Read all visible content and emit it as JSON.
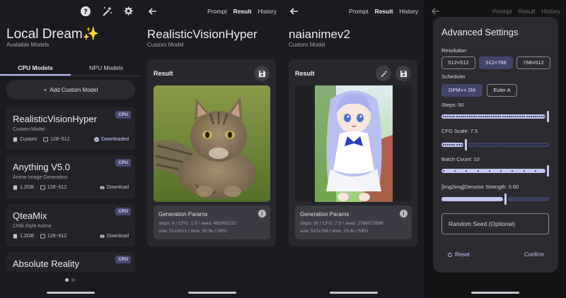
{
  "home": {
    "title": "Local Dream✨",
    "subtitle": "Available Models",
    "tabs": [
      "CPU Models",
      "NPU Models"
    ],
    "add_button": "Add Custom Model",
    "models": [
      {
        "name": "RealisticVisionHyper",
        "desc": "Custom Model",
        "badge": "CPU",
        "size": "Custom",
        "res": "128~512",
        "status": "Downloaded"
      },
      {
        "name": "Anything V5.0",
        "desc": "Anime Image Generation",
        "badge": "CPU",
        "size": "1.2GB",
        "res": "128~512",
        "status": "Download"
      },
      {
        "name": "QteaMix",
        "desc": "Chibi Style Anime",
        "badge": "CPU",
        "size": "1.2GB",
        "res": "128~512",
        "status": "Download"
      },
      {
        "name": "Absolute Reality",
        "desc": "",
        "badge": "CPU",
        "size": "",
        "res": "",
        "status": ""
      }
    ],
    "page_dots": 2,
    "active_dot": 0
  },
  "nav": {
    "prompt": "Prompt",
    "result": "Result",
    "history": "History"
  },
  "result1": {
    "title": "RealisticVisionHyper",
    "subtitle": "Custom Model",
    "card_title": "Result",
    "params_title": "Generation Params",
    "line1": "steps: 8 / CFG: 1.5 / seed: 461092232",
    "line2": "size: 512x512 / time: 30.9s / GPU"
  },
  "result2": {
    "title": "naianimev2",
    "subtitle": "Custom Model",
    "card_title": "Result",
    "params_title": "Generation Params",
    "line1": "steps: 50 / CFG: 7.5 / seed: 1788573599",
    "line2": "size: 512x768 / time: 23.8s / NPU"
  },
  "settings": {
    "title": "Advanced Settings",
    "resolution_label": "Resolution",
    "resolutions": [
      "512×512",
      "512×768",
      "768×512"
    ],
    "selected_resolution": "512×768",
    "scheduler_label": "Scheduler",
    "schedulers": [
      "DPM++ 2M",
      "Euler A"
    ],
    "selected_scheduler": "DPM++ 2M",
    "steps_label": "Steps: 50",
    "steps_fraction": 1.0,
    "cfg_label": "CFG Scale: 7.5",
    "cfg_fraction": 0.22,
    "batch_label": "Batch Count: 10",
    "batch_fraction": 1.0,
    "denoise_label": "[img2img]Denoise Strength: 0.60",
    "denoise_fraction": 0.6,
    "seed_placeholder": "Random Seed (Optional)",
    "reset": "Reset",
    "confirm": "Confirm"
  },
  "colors": {
    "accent": "#b8c3ff",
    "badge_bg": "#4a4a72",
    "background": "#1b1b1f",
    "card": "#232329"
  }
}
